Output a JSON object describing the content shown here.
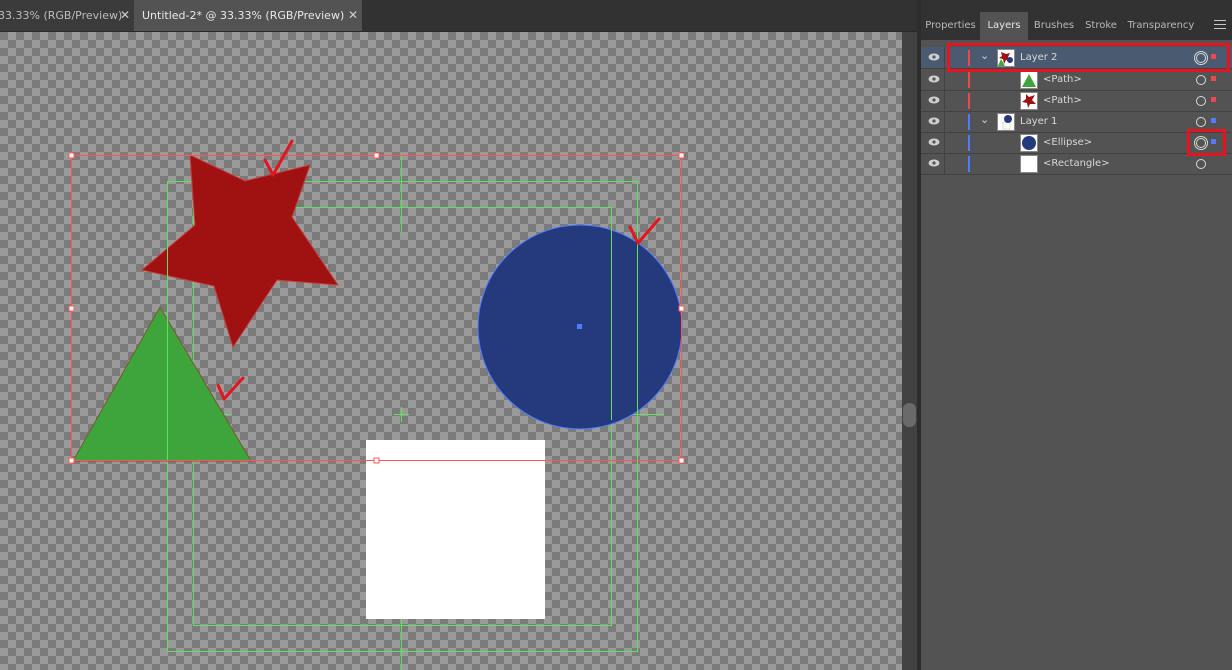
{
  "document_tabs": [
    {
      "label": "33.33% (RGB/Preview)",
      "active": false
    },
    {
      "label": "Untitled-2* @ 33.33% (RGB/Preview)",
      "active": true
    }
  ],
  "tab_close_glyph": "✕",
  "panel": {
    "tabs": [
      "Properties",
      "Layers",
      "Brushes",
      "Stroke",
      "Transparency"
    ],
    "active_tab": "Layers",
    "menu_icon": "hamburger-menu-icon"
  },
  "layers": [
    {
      "name": "Layer 2",
      "level": 0,
      "expanded": true,
      "selected": true,
      "color": "#f0474b",
      "thumb": "layer2-thumbnail",
      "target": "double",
      "highlighted": true
    },
    {
      "name": "<Path>",
      "level": 1,
      "color": "#f0474b",
      "thumb": "triangle-thumbnail",
      "target": "single"
    },
    {
      "name": "<Path>",
      "level": 1,
      "color": "#f0474b",
      "thumb": "star-thumbnail",
      "target": "single"
    },
    {
      "name": "Layer 1",
      "level": 0,
      "expanded": true,
      "color": "#4f7bff",
      "thumb": "layer1-thumbnail",
      "target": "single"
    },
    {
      "name": "<Ellipse>",
      "level": 1,
      "color": "#4f7bff",
      "thumb": "ellipse-thumbnail",
      "target": "double",
      "highlighted": true
    },
    {
      "name": "<Rectangle>",
      "level": 1,
      "color": "#4f7bff",
      "thumb": "rectangle-thumbnail",
      "target": "single"
    }
  ],
  "artwork": {
    "star_color": "#a01212",
    "triangle_color": "#3ea43c",
    "ellipse_color": "#25397d",
    "rectangle_color": "#ffffff",
    "selection_color": "#ff5555",
    "guide_color": "#5fe05f",
    "highlight_color": "#e5141e"
  }
}
